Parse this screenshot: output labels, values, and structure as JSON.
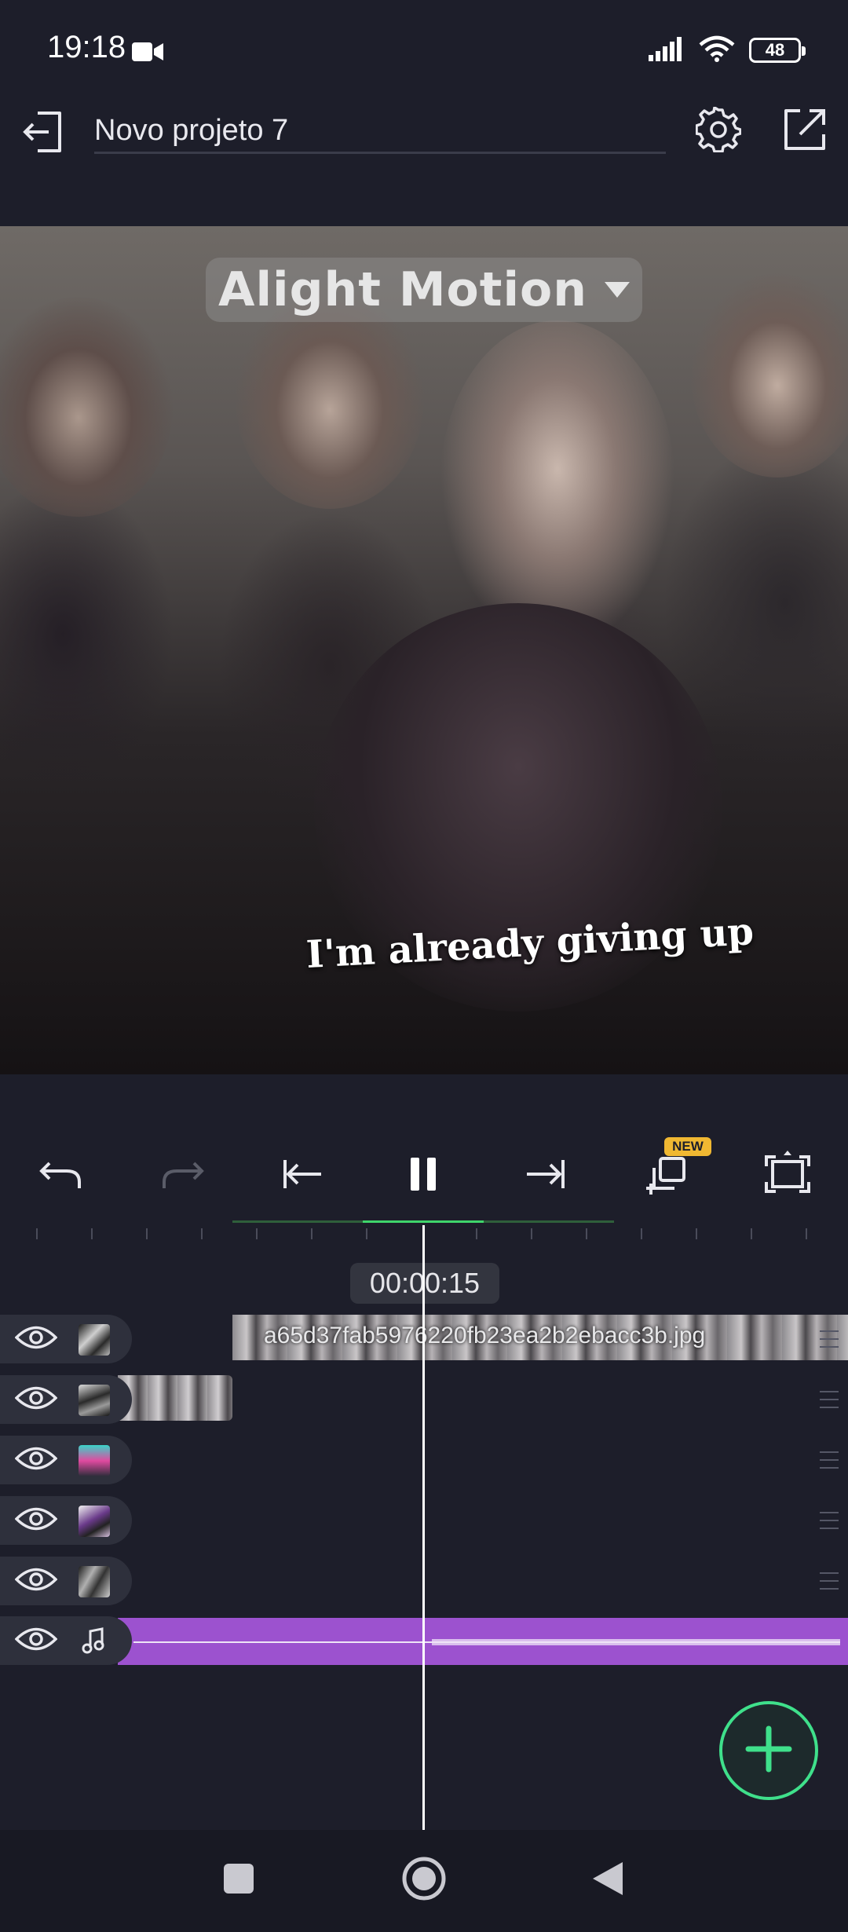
{
  "status_bar": {
    "time": "19:18",
    "battery": "48"
  },
  "toolbar": {
    "project_title": "Novo projeto 7",
    "icons": {
      "exit": "exit-icon",
      "settings": "gear-icon",
      "export": "export-icon"
    }
  },
  "preview": {
    "watermark": "Alight Motion",
    "lyric": "I'm already giving up"
  },
  "playback": {
    "badge": "NEW",
    "timecode": "00:00:15",
    "icons": [
      "undo-icon",
      "redo-icon",
      "skip-start-icon",
      "pause-icon",
      "skip-end-icon",
      "duplicate-icon",
      "fullscreen-icon"
    ]
  },
  "timeline": {
    "tracks": [
      {
        "type": "image",
        "clip_label": "a65d37fab5976220fb23ea2b2ebacc3b.jpg"
      },
      {
        "type": "image",
        "clip_label": ""
      },
      {
        "type": "image",
        "clip_label": ""
      },
      {
        "type": "image",
        "clip_label": ""
      },
      {
        "type": "image",
        "clip_label": ""
      },
      {
        "type": "audio",
        "clip_label": ""
      }
    ]
  },
  "colors": {
    "background": "#1d1e2a",
    "accent_green": "#3fe08b",
    "audio_purple": "#9c52cf",
    "badge_yellow": "#f0b832"
  },
  "nav_bar": {
    "icons": [
      "recents-icon",
      "home-icon",
      "back-icon"
    ]
  }
}
